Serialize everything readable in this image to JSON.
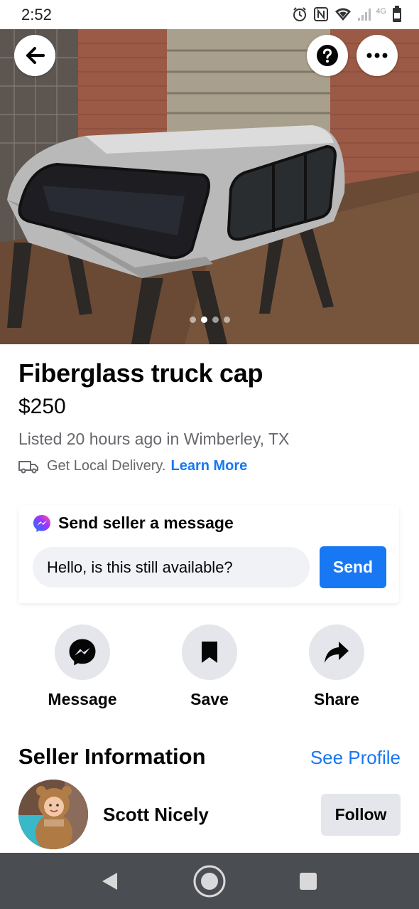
{
  "status_bar": {
    "time": "2:52",
    "network_label": "4G",
    "icons": [
      "alarm-icon",
      "nfc-icon",
      "wifi-icon",
      "signal-icon",
      "battery-icon"
    ]
  },
  "hero": {
    "image_count": 4,
    "active_index": 1,
    "icons": [
      "back-arrow-icon",
      "help-icon",
      "more-icon"
    ]
  },
  "listing": {
    "title": "Fiberglass truck cap",
    "price": "$250",
    "meta": "Listed 20 hours ago in Wimberley, TX",
    "delivery_text": "Get Local Delivery.",
    "learn_more": "Learn More"
  },
  "message_card": {
    "heading": "Send seller a message",
    "input_value": "Hello, is this still available?",
    "send_label": "Send"
  },
  "actions": [
    {
      "label": "Message",
      "icon": "messenger-icon"
    },
    {
      "label": "Save",
      "icon": "bookmark-icon"
    },
    {
      "label": "Share",
      "icon": "share-icon"
    }
  ],
  "seller": {
    "heading": "Seller Information",
    "see_profile": "See Profile",
    "name": "Scott Nicely",
    "follow_label": "Follow"
  },
  "colors": {
    "accent": "#1877f2",
    "secondary_text": "#65676b",
    "button_gray": "#e4e6eb",
    "nav_bar": "#4a4d52"
  }
}
